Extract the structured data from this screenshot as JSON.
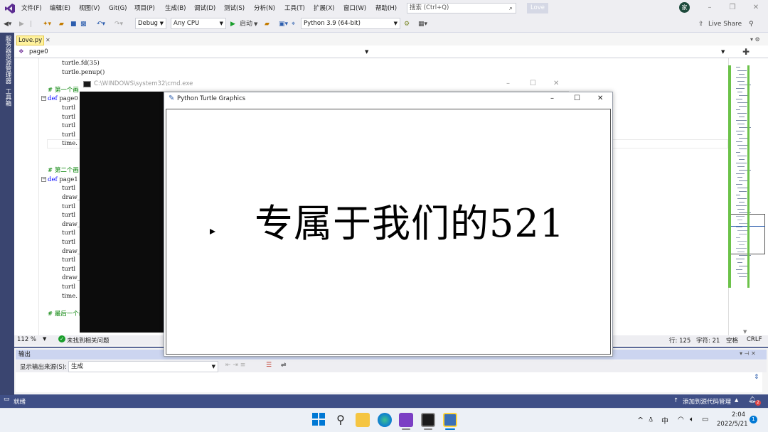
{
  "menubar": {
    "items": [
      "文件(F)",
      "编辑(E)",
      "视图(V)",
      "Git(G)",
      "项目(P)",
      "生成(B)",
      "调试(D)",
      "测试(S)",
      "分析(N)",
      "工具(T)",
      "扩展(X)",
      "窗口(W)",
      "帮助(H)"
    ],
    "search_placeholder": "搜索 (Ctrl+Q)",
    "solution_name": "Love",
    "avatar_letter": "家"
  },
  "toolbar": {
    "config": "Debug",
    "platform": "Any CPU",
    "start_label": "启动",
    "python_env": "Python 3.9 (64-bit)",
    "live_share": "Live Share"
  },
  "leftstrip": {
    "server_explorer": "服务器资源管理器",
    "toolbox": "工具箱"
  },
  "tabs": {
    "file": "Love.py",
    "function_combo": "page0"
  },
  "code_lines": [
    {
      "indent": 2,
      "text": "turtle.fd(35)",
      "kind": "code"
    },
    {
      "indent": 2,
      "text": "turtle.penup()",
      "kind": "code"
    },
    {
      "indent": 0,
      "text": "",
      "kind": "blank"
    },
    {
      "indent": 1,
      "text": "# 第一个画",
      "kind": "comment"
    },
    {
      "indent": 0,
      "text": "def page0",
      "kind": "def"
    },
    {
      "indent": 2,
      "text": "turtl",
      "kind": "code"
    },
    {
      "indent": 2,
      "text": "turtl",
      "kind": "code"
    },
    {
      "indent": 2,
      "text": "turtl",
      "kind": "code"
    },
    {
      "indent": 2,
      "text": "turtl",
      "kind": "code"
    },
    {
      "indent": 2,
      "text": "time.",
      "kind": "code"
    },
    {
      "indent": 0,
      "text": "",
      "kind": "blank"
    },
    {
      "indent": 0,
      "text": "",
      "kind": "blank"
    },
    {
      "indent": 1,
      "text": "# 第二个画",
      "kind": "comment"
    },
    {
      "indent": 0,
      "text": "def page1",
      "kind": "def"
    },
    {
      "indent": 2,
      "text": "turtl",
      "kind": "code"
    },
    {
      "indent": 2,
      "text": "draw_",
      "kind": "code"
    },
    {
      "indent": 2,
      "text": "turtl",
      "kind": "code"
    },
    {
      "indent": 2,
      "text": "turtl",
      "kind": "code"
    },
    {
      "indent": 2,
      "text": "draw_",
      "kind": "code"
    },
    {
      "indent": 2,
      "text": "turtl",
      "kind": "code"
    },
    {
      "indent": 2,
      "text": "turtl",
      "kind": "code"
    },
    {
      "indent": 2,
      "text": "draw_",
      "kind": "code"
    },
    {
      "indent": 2,
      "text": "turtl",
      "kind": "code"
    },
    {
      "indent": 2,
      "text": "turtl",
      "kind": "code"
    },
    {
      "indent": 2,
      "text": "draw_",
      "kind": "code"
    },
    {
      "indent": 2,
      "text": "turtl",
      "kind": "code"
    },
    {
      "indent": 2,
      "text": "time.",
      "kind": "code"
    },
    {
      "indent": 0,
      "text": "",
      "kind": "blank"
    },
    {
      "indent": 1,
      "text": "# 最后一个画面",
      "kind": "comment"
    }
  ],
  "editor_status": {
    "zoom": "112 %",
    "issues": "未找到相关问题",
    "line": "行: 125",
    "col": "字符: 21",
    "whitespace": "空格",
    "eol": "CRLF"
  },
  "output": {
    "title": "输出",
    "source_label": "显示输出来源(S):",
    "source_value": "生成"
  },
  "statusbar": {
    "ready": "就绪",
    "add_source": "添加到源代码管理",
    "notification_count": "2"
  },
  "cmd_window": {
    "title": "C:\\WINDOWS\\system32\\cmd.exe"
  },
  "turtle_window": {
    "title": "Python Turtle Graphics",
    "canvas_text": "专属于我们的521"
  },
  "taskbar": {
    "ime": "中",
    "time": "2:04",
    "date": "2022/5/21",
    "notification_badge": "1"
  },
  "colors": {
    "vs_chrome": "#eeeef2",
    "status_bar": "#3f4f86",
    "left_strip": "#3a4570",
    "cmd_bg": "#0c0c0c",
    "tab_yellow": "#fff29d"
  }
}
